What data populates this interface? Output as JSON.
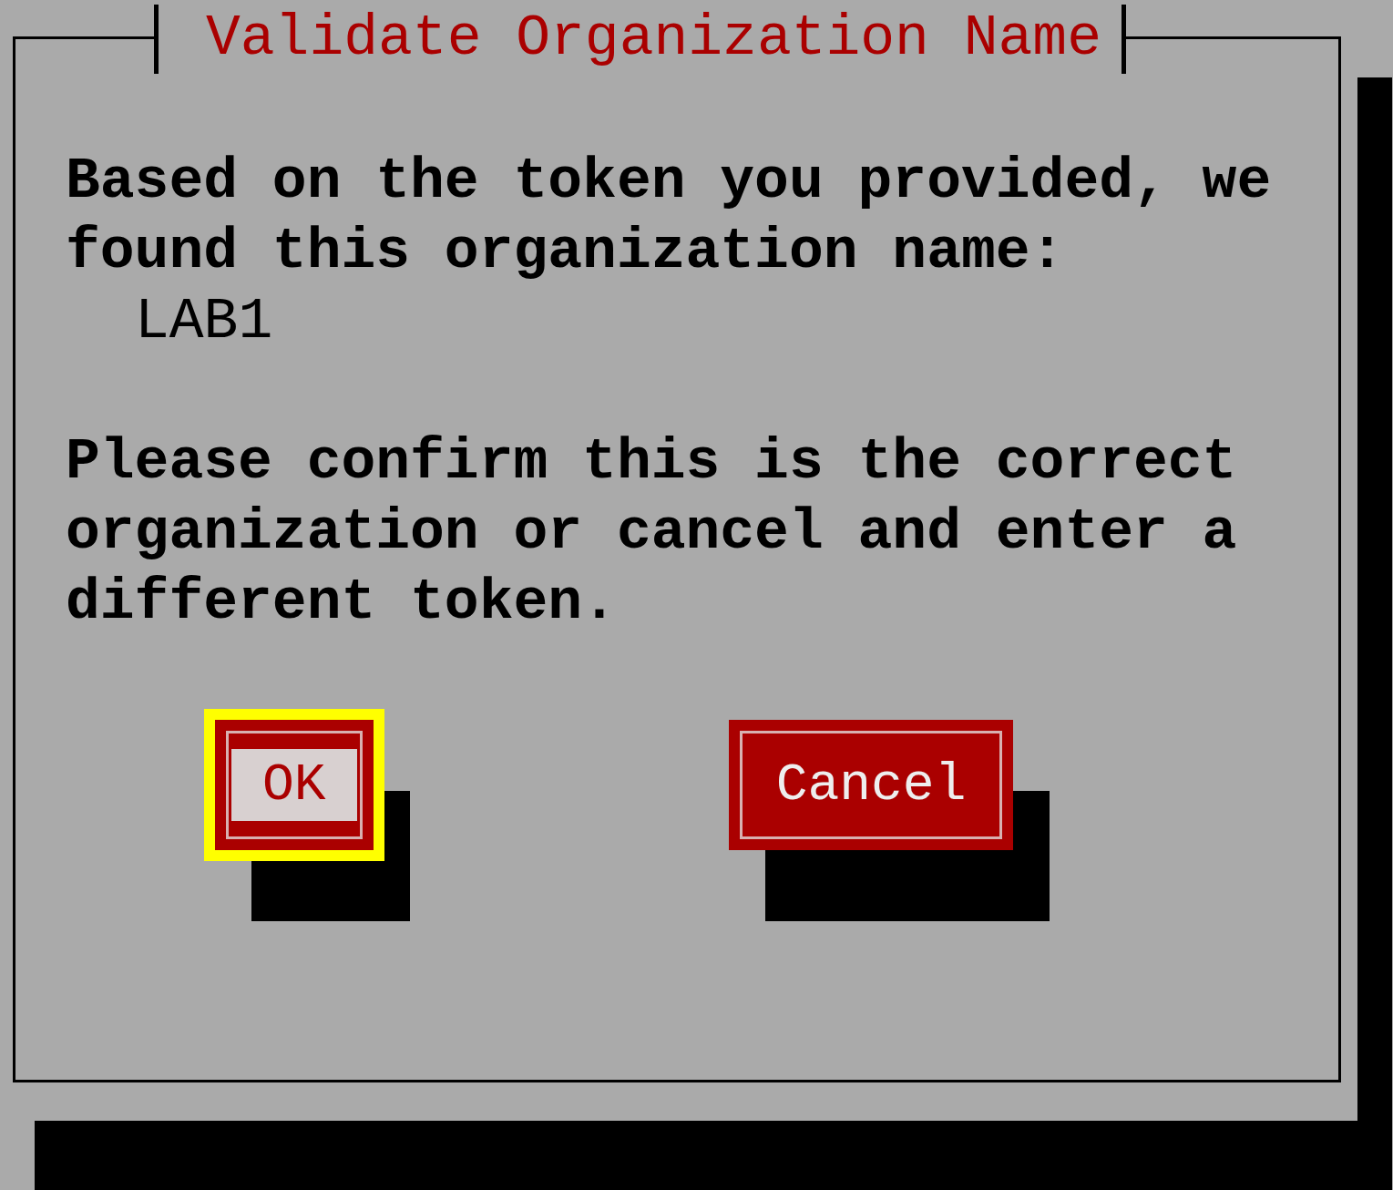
{
  "dialog": {
    "title": "Validate Organization Name",
    "message": "Based on the token you provided, we found this organization name:",
    "organization": "LAB1",
    "instruction": "Please confirm this is the correct organization or cancel and enter a different token.",
    "buttons": [
      {
        "label": "OK",
        "selected": true
      },
      {
        "label": "Cancel",
        "selected": false
      }
    ]
  }
}
